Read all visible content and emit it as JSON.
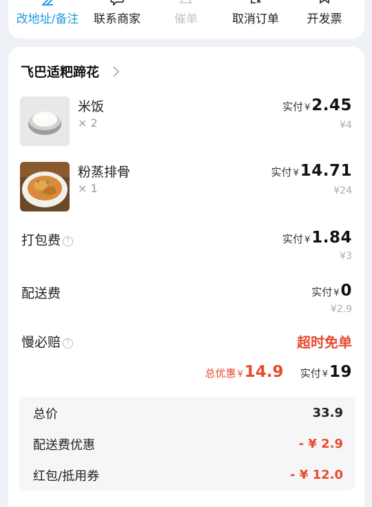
{
  "actions": [
    {
      "label": "改地址/备注",
      "icon": "edit-icon",
      "active": true
    },
    {
      "label": "联系商家",
      "icon": "chat-icon",
      "active": false
    },
    {
      "label": "催单",
      "icon": "bell-icon",
      "disabled": true
    },
    {
      "label": "取消订单",
      "icon": "cancel-order-icon",
      "active": false
    },
    {
      "label": "开发票",
      "icon": "invoice-icon",
      "active": false
    }
  ],
  "shop": {
    "name": "飞巴适粑蹄花"
  },
  "items": [
    {
      "name": "米饭",
      "qty": "× 2",
      "paid_label": "实付",
      "currency": "¥",
      "paid": "2.45",
      "original": "¥4"
    },
    {
      "name": "粉蒸排骨",
      "qty": "× 1",
      "paid_label": "实付",
      "currency": "¥",
      "paid": "14.71",
      "original": "¥24"
    }
  ],
  "fees": {
    "packing": {
      "label": "打包费",
      "paid_label": "实付",
      "currency": "¥",
      "paid": "1.84",
      "original": "¥3"
    },
    "delivery": {
      "label": "配送费",
      "paid_label": "实付",
      "currency": "¥",
      "paid": "0",
      "original": "¥2.9"
    },
    "guarantee": {
      "label": "慢必赔",
      "value": "超时免单"
    }
  },
  "totals": {
    "discount_label": "总优惠",
    "discount_currency": "¥",
    "discount": "14.9",
    "paid_label": "实付",
    "paid_currency": "¥",
    "paid": "19"
  },
  "summary": {
    "total_label": "总价",
    "total_value": "33.9",
    "delivery_discount_label": "配送费优惠",
    "delivery_discount_value": "- ¥ 2.9",
    "coupon_label": "红包/抵用券",
    "coupon_value": "- ¥ 12.0"
  },
  "colors": {
    "accent": "#1e9be0",
    "highlight": "#e84a2f",
    "background": "#eef1f5"
  }
}
